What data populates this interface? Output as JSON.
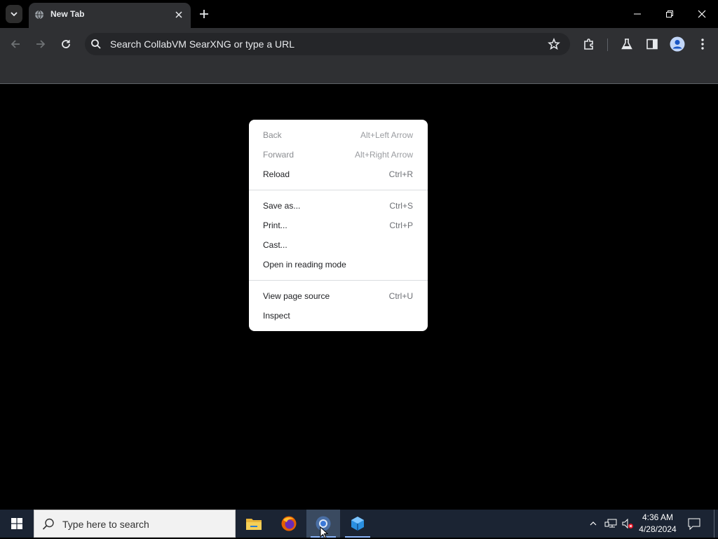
{
  "tab": {
    "title": "New Tab"
  },
  "omnibox": {
    "placeholder": "Search CollabVM SearXNG or type a URL"
  },
  "context_menu": {
    "groups": [
      [
        {
          "label": "Back",
          "shortcut": "Alt+Left Arrow",
          "disabled": true
        },
        {
          "label": "Forward",
          "shortcut": "Alt+Right Arrow",
          "disabled": true
        },
        {
          "label": "Reload",
          "shortcut": "Ctrl+R",
          "disabled": false
        }
      ],
      [
        {
          "label": "Save as...",
          "shortcut": "Ctrl+S",
          "disabled": false
        },
        {
          "label": "Print...",
          "shortcut": "Ctrl+P",
          "disabled": false
        },
        {
          "label": "Cast...",
          "shortcut": "",
          "disabled": false
        },
        {
          "label": "Open in reading mode",
          "shortcut": "",
          "disabled": false
        }
      ],
      [
        {
          "label": "View page source",
          "shortcut": "Ctrl+U",
          "disabled": false
        },
        {
          "label": "Inspect",
          "shortcut": "",
          "disabled": false
        }
      ]
    ]
  },
  "taskbar": {
    "search_placeholder": "Type here to search",
    "time": "4:36 AM",
    "date": "4/28/2024"
  },
  "colors": {
    "toolbar": "#2f3033",
    "omnibox": "#252629",
    "taskbar": "#1b2433"
  }
}
